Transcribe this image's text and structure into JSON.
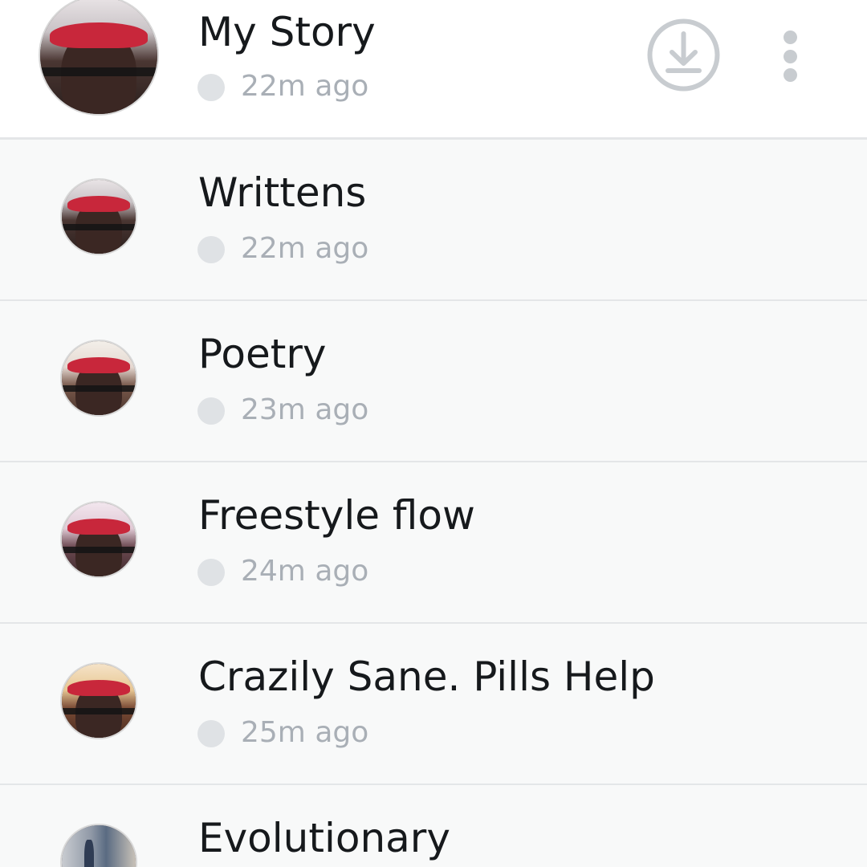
{
  "my_story": {
    "title": "My Story",
    "time": "22m ago",
    "avatar_caption": "Writtens",
    "download_icon": "download-circle-icon",
    "more_icon": "vertical-ellipsis-icon"
  },
  "snaps": [
    {
      "title": "Writtens",
      "time": "22m ago",
      "avatar_caption": "Writtens"
    },
    {
      "title": "Poetry",
      "time": "23m ago",
      "avatar_caption": "Poetry"
    },
    {
      "title": "Freestyle flow",
      "time": "24m ago",
      "avatar_caption": "Freestyle flow"
    },
    {
      "title": "Crazily Sane. Pills Help",
      "time": "25m ago",
      "avatar_caption": "Crazily Sane. Pills Help"
    },
    {
      "title": "Evolutionary",
      "time": "",
      "avatar_caption": ""
    }
  ],
  "colors": {
    "title_text": "#16191c",
    "time_text": "#a9afb6",
    "row_bg": "#f8f9f9",
    "divider": "#e4e6e8",
    "icon_gray": "#c8ccd0"
  }
}
